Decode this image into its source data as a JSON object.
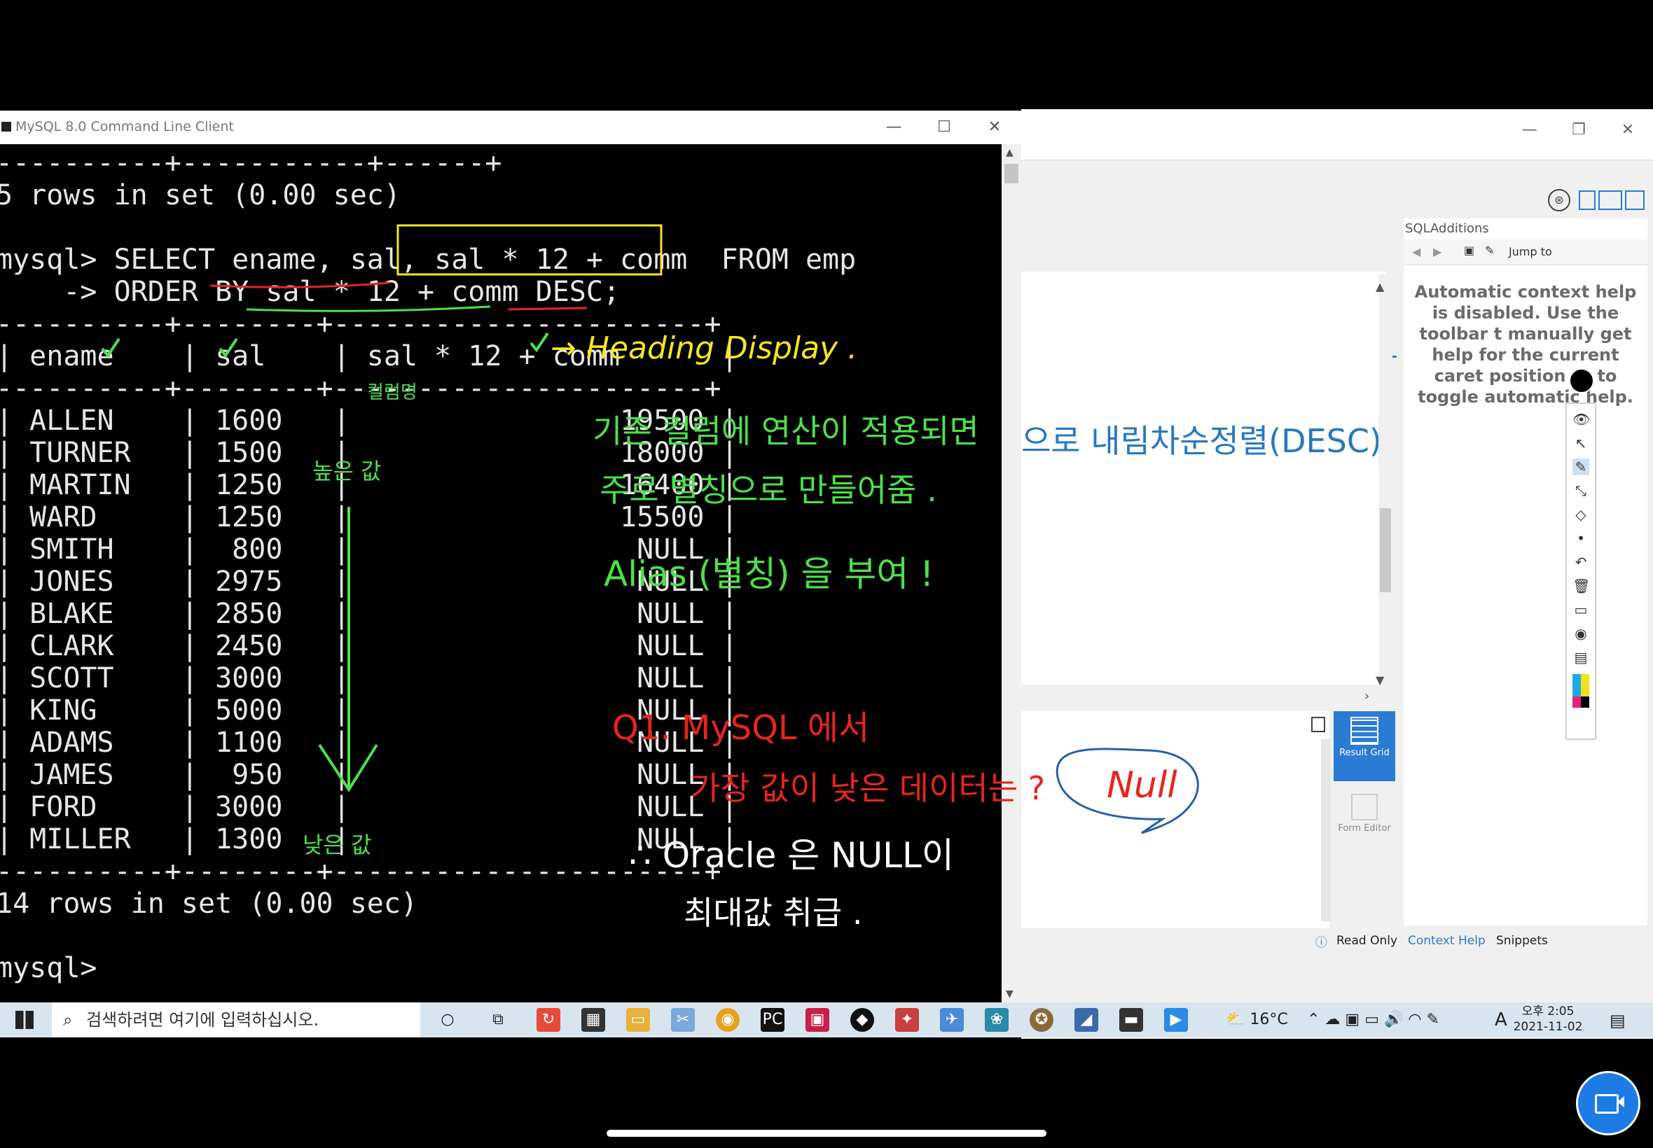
{
  "mysql_window": {
    "title": "MySQL 8.0 Command Line Client",
    "min": "—",
    "max": "☐",
    "close": "✕"
  },
  "console": {
    "lines": [
      "----------+-----------+------+",
      "5 rows in set (0.00 sec)",
      "",
      "mysql> SELECT ename, sal, sal * 12 + comm  FROM emp",
      "    -> ORDER BY sal * 12 + comm DESC;",
      "----------+--------+----------------------+",
      "| ename    | sal    | sal * 12 + comm      |",
      "----------+--------+----------------------+",
      "| ALLEN    | 1600   |                19500 |",
      "| TURNER   | 1500   |                18000 |",
      "| MARTIN   | 1250   |                16400 |",
      "| WARD     | 1250   |                15500 |",
      "| SMITH    |  800   |                 NULL |",
      "| JONES    | 2975   |                 NULL |",
      "| BLAKE    | 2850   |                 NULL |",
      "| CLARK    | 2450   |                 NULL |",
      "| SCOTT    | 3000   |                 NULL |",
      "| KING     | 5000   |                 NULL |",
      "| ADAMS    | 1100   |                 NULL |",
      "| JAMES    |  950   |                 NULL |",
      "| FORD     | 3000   |                 NULL |",
      "| MILLER   | 1300   |                 NULL |",
      "----------+--------+----------------------+",
      "14 rows in set (0.00 sec)",
      "",
      "mysql>"
    ]
  },
  "annotations": {
    "heading_display": "→ Heading Display .",
    "korean_line1": "기존 컬럼에 연산이 적용되면",
    "korean_line2": "주로 별칭으로 만들어줌 .",
    "alias_note": "Alias (별칭) 을 부여 !",
    "column_note": "컬럼명",
    "high_value": "높은 값",
    "low_value": "낮은 값",
    "q1_line1": "Q1. MySQL 에서",
    "q1_line2": "가장 값이 낮은 데이터는 ?",
    "null_answer": "Null",
    "oracle_line1": "∴ Oracle 은 NULL이",
    "oracle_line2": "최대값 취급 ."
  },
  "workbench": {
    "editor_text": "으로 내림차순정렬(DESC)",
    "sql_additions_title": "SQLAdditions",
    "jump_to": "Jump to",
    "context_help_text": "Automatic context help is disabled. Use the toolbar t manually get help for the current caret position or to toggle automatic help.",
    "result_grid": "Result Grid",
    "form_editor": "Form Editor",
    "read_only": "Read Only",
    "context_help_tab": "Context Help",
    "snippets_tab": "Snippets"
  },
  "taskbar": {
    "search_placeholder": "검색하려면 여기에 입력하십시오.",
    "weather": "16°C",
    "time": "오후 2:05",
    "date": "2021-11-02",
    "ime": "A"
  },
  "colors": {
    "annotation_yellow": "#f5e61e",
    "annotation_green": "#4de04a",
    "annotation_red": "#e8241e",
    "annotation_white": "#ffffff",
    "annotation_blue": "#2a5fa8",
    "workbench_blue": "#2878c0"
  }
}
